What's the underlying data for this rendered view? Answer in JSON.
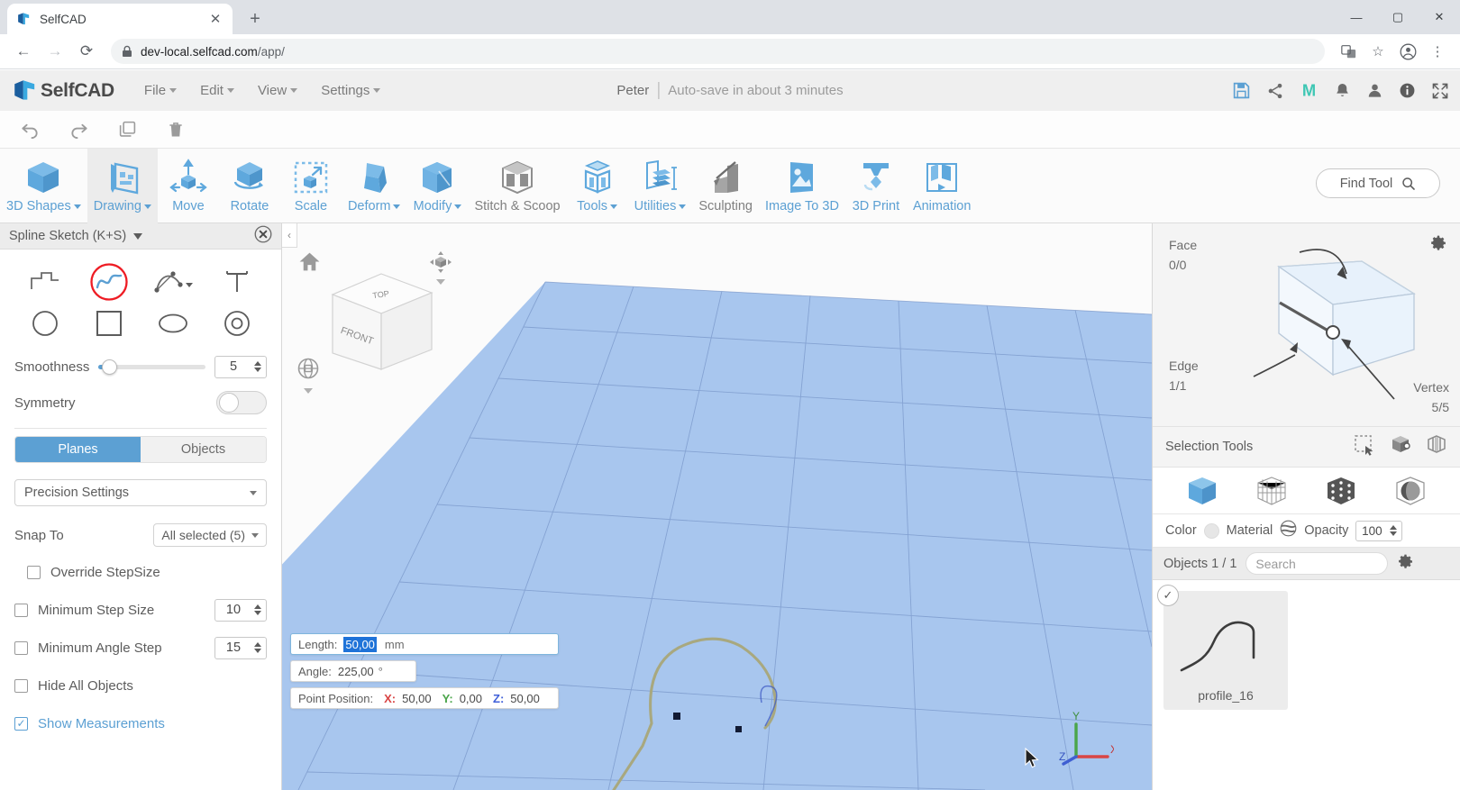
{
  "browser": {
    "tab_title": "SelfCAD",
    "tab_close": "✕",
    "new_tab": "+",
    "url_main": "dev-local.selfcad.com",
    "url_path": "/app/",
    "back_icon": "←",
    "forward_icon": "→",
    "reload_icon": "⟳",
    "lock_icon": "lock-icon",
    "translate_icon": "translate-icon",
    "star_icon": "☆",
    "profile_icon": "profile-icon",
    "menu_icon": "⋮",
    "minimize": "—",
    "maximize": "▢",
    "close": "✕"
  },
  "header": {
    "brand": "SelfCAD",
    "menus": [
      "File",
      "Edit",
      "View",
      "Settings"
    ],
    "user": "Peter",
    "autosave": "Auto-save in about 3 minutes",
    "right_icons": [
      "save-icon",
      "share-icon",
      "m-logo-icon",
      "bell-icon",
      "account-icon",
      "info-icon",
      "fullscreen-icon"
    ]
  },
  "undo_bar": {
    "items": [
      "undo-icon",
      "redo-icon",
      "copy-icon",
      "delete-icon"
    ]
  },
  "toolbar": {
    "tools": [
      {
        "label": "3D Shapes",
        "icon": "cube-icon",
        "caret": true,
        "active": false,
        "gray": false
      },
      {
        "label": "Drawing",
        "icon": "drawing-icon",
        "caret": true,
        "active": true,
        "gray": false
      },
      {
        "label": "Move",
        "icon": "move-icon",
        "caret": false,
        "active": false,
        "gray": false
      },
      {
        "label": "Rotate",
        "icon": "rotate-icon",
        "caret": false,
        "active": false,
        "gray": false
      },
      {
        "label": "Scale",
        "icon": "scale-icon",
        "caret": false,
        "active": false,
        "gray": false
      },
      {
        "label": "Deform",
        "icon": "deform-icon",
        "caret": true,
        "active": false,
        "gray": false
      },
      {
        "label": "Modify",
        "icon": "modify-icon",
        "caret": true,
        "active": false,
        "gray": false
      },
      {
        "label": "Stitch & Scoop",
        "icon": "stitch-scoop-icon",
        "caret": false,
        "active": false,
        "gray": true
      },
      {
        "label": "Tools",
        "icon": "tools-icon",
        "caret": true,
        "active": false,
        "gray": false
      },
      {
        "label": "Utilities",
        "icon": "utilities-icon",
        "caret": true,
        "active": false,
        "gray": false
      },
      {
        "label": "Sculpting",
        "icon": "sculpting-icon",
        "caret": false,
        "active": false,
        "gray": true
      },
      {
        "label": "Image To 3D",
        "icon": "image-to-3d-icon",
        "caret": false,
        "active": false,
        "gray": false
      },
      {
        "label": "3D Print",
        "icon": "3d-print-icon",
        "caret": false,
        "active": false,
        "gray": false
      },
      {
        "label": "Animation",
        "icon": "animation-icon",
        "caret": false,
        "active": false,
        "gray": false
      }
    ],
    "find_tool": "Find Tool",
    "find_tool_icon": "search-icon"
  },
  "left_panel": {
    "title": "Spline Sketch (K+S)",
    "close_icon": "close-icon",
    "shapes": [
      {
        "name": "polyline-icon",
        "selected": false
      },
      {
        "name": "spline-icon",
        "selected": true
      },
      {
        "name": "bezier-icon",
        "selected": false
      },
      {
        "name": "text-icon",
        "selected": false
      },
      {
        "name": "circle-icon",
        "selected": false
      },
      {
        "name": "square-icon",
        "selected": false
      },
      {
        "name": "ellipse-icon",
        "selected": false
      },
      {
        "name": "ring-icon",
        "selected": false
      }
    ],
    "smoothness_label": "Smoothness",
    "smoothness_value": "5",
    "symmetry_label": "Symmetry",
    "symmetry_on": false,
    "segmented": {
      "planes": "Planes",
      "objects": "Objects",
      "selected": "Planes"
    },
    "precision_settings": "Precision Settings",
    "snap_to_label": "Snap To",
    "snap_to_value": "All selected (5)",
    "checkboxes": [
      {
        "label": "Override StepSize",
        "checked": false,
        "value": null,
        "indent": true,
        "blue": false
      },
      {
        "label": "Minimum Step Size",
        "checked": false,
        "value": "10",
        "indent": false,
        "blue": false
      },
      {
        "label": "Minimum Angle Step",
        "checked": false,
        "value": "15",
        "indent": false,
        "blue": false
      },
      {
        "label": "Hide All Objects",
        "checked": false,
        "value": null,
        "indent": false,
        "blue": false
      },
      {
        "label": "Show Measurements",
        "checked": true,
        "value": null,
        "indent": false,
        "blue": true
      }
    ]
  },
  "viewport": {
    "collapse_icon": "‹",
    "home_icon": "home-icon",
    "orbit_icon": "orbit-icon",
    "pan_icon": "pan-icon",
    "viewcube_top": "TOP",
    "viewcube_front": "FRONT",
    "axis": {
      "x": "X",
      "y": "Y",
      "z": "Z"
    },
    "measurements": {
      "length_label": "Length:",
      "length_value": "50,00",
      "length_unit": "mm",
      "angle_label": "Angle:",
      "angle_value": "225,00",
      "angle_unit": "°",
      "point_position_label": "Point Position:",
      "x_label": "X:",
      "x_value": "50,00",
      "y_label": "Y:",
      "y_value": "0,00",
      "z_label": "Z:",
      "z_value": "50,00"
    }
  },
  "right_panel": {
    "gear_icon": "gear-icon",
    "face_label": "Face",
    "face_count": "0/0",
    "edge_label": "Edge",
    "edge_count": "1/1",
    "vertex_label": "Vertex",
    "vertex_count": "5/5",
    "selection_tools_label": "Selection Tools",
    "selection_tool_icons": [
      "rect-select-icon",
      "object-select-icon",
      "loop-select-icon"
    ],
    "mode_icons": [
      "solid-mode-icon",
      "wireframe-mode-icon",
      "points-mode-icon",
      "xray-mode-icon"
    ],
    "color_label": "Color",
    "material_label": "Material",
    "material_icon": "material-sphere-icon",
    "opacity_label": "Opacity",
    "opacity_value": "100",
    "objects_count": "Objects 1 / 1",
    "search_placeholder": "Search",
    "search_icon": "search-icon",
    "settings_icon": "gear-icon",
    "objects": [
      {
        "name": "profile_16",
        "checked": true,
        "check_icon": "✓"
      }
    ]
  },
  "colors": {
    "accent": "#5ca0d3",
    "grid_plane": "#a8c6ee",
    "highlight_red": "#ee1c24",
    "selection_blue": "#1f73d8"
  }
}
